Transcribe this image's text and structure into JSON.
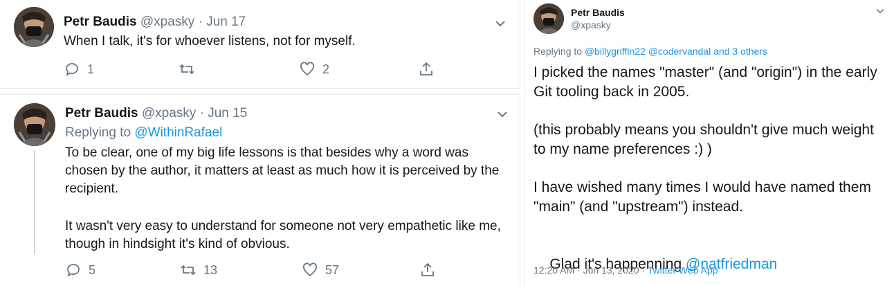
{
  "tweet_a": {
    "name": "Petr Baudis",
    "handle": "@xpasky",
    "separator": "·",
    "date": "Jun 17",
    "text": "When I talk, it's for whoever listens, not for myself.",
    "replies": "1",
    "retweets": "",
    "likes": "2"
  },
  "tweet_b": {
    "name": "Petr Baudis",
    "handle": "@xpasky",
    "separator": "·",
    "date": "Jun 15",
    "replying_prefix": "Replying to ",
    "replying_to": "@WithinRafael",
    "paragraph1": "To be clear, one of my big life lessons is that besides why a word was chosen by the author, it matters at least as much how it is perceived by the recipient.",
    "paragraph2": "It wasn't very easy to understand for someone not very empathetic like me, though in hindsight it's kind of obvious.",
    "replies": "5",
    "retweets": "13",
    "likes": "57"
  },
  "tweet_c": {
    "name": "Petr Baudis",
    "handle": "@xpasky",
    "replying_prefix": "Replying to ",
    "replying_to_1": "@billygriffin22",
    "replying_to_2": "@codervandal",
    "replying_suffix": " and 3 others",
    "paragraph1": "I picked the names \"master\" (and \"origin\") in the early Git tooling back in 2005.",
    "paragraph2": "(this probably means you shouldn't give much weight to my name preferences :) )",
    "paragraph3": "I have wished many times I would have named them \"main\" (and \"upstream\") instead.",
    "paragraph4_prefix": "Glad it's happenning ",
    "paragraph4_mention": "@natfriedman",
    "timestamp": "12:20 AM · Jun 13, 2020 · ",
    "source": "Twitter Web App"
  },
  "colors": {
    "link": "#1b95e0",
    "muted": "#657786",
    "text": "#14171a",
    "divider": "#e6ecf0"
  },
  "icons": [
    "reply-icon",
    "retweet-icon",
    "like-icon",
    "share-icon",
    "chevron-down-icon",
    "avatar"
  ]
}
